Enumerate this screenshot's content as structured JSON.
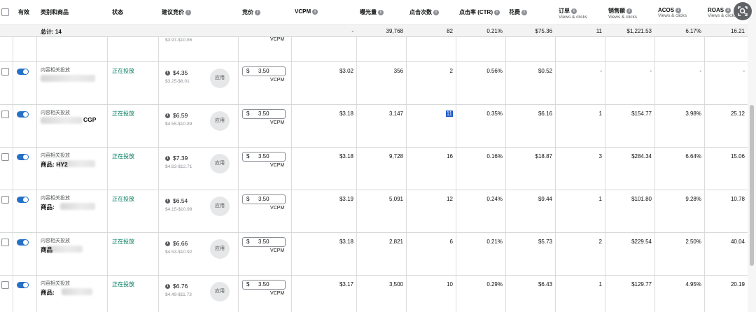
{
  "header": {
    "enabled": "有效",
    "category": "类别和商品",
    "status": "状态",
    "suggested_bid": "建议竞价",
    "bid": "竞价",
    "vcpm": "VCPM",
    "impressions": "曝光量",
    "clicks": "点击次数",
    "ctr": "点击率 (CTR)",
    "spend": "花费",
    "orders": "订单",
    "orders_sub": "Views & clicks",
    "sales": "销售额",
    "sales_sub": "Views & clicks",
    "acos": "ACOS",
    "acos_sub": "Views & clicks",
    "roas": "ROAS",
    "roas_sub": "Views & clicks"
  },
  "totals": {
    "label": "总计: 14",
    "vcpm": "-",
    "impressions": "39,768",
    "clicks": "82",
    "ctr": "0.21%",
    "spend": "$75.36",
    "orders": "11",
    "sales": "$1,221.53",
    "acos": "6.17%",
    "roas": "16.21",
    "partial_range": "$3.97-$10.86",
    "partial_vcpm": "VCPM"
  },
  "rows": [
    {
      "category": "内容相关投放",
      "product": "",
      "status": "正在投放",
      "bid_suggest": "$4.35",
      "bid_range": "$3.25-$8.01",
      "apply": "应用",
      "cur": "$",
      "bid": "3.50",
      "bid_type": "VCPM",
      "vcpm": "$3.02",
      "impressions": "356",
      "clicks": "2",
      "ctr": "0.56%",
      "spend": "$0.52",
      "orders": "-",
      "sales": "-",
      "acos": "-",
      "roas": "-"
    },
    {
      "category": "内容相关投放",
      "product": "CGP",
      "status": "正在投放",
      "bid_suggest": "$6.59",
      "bid_range": "$4.55-$10.89",
      "apply": "应用",
      "cur": "$",
      "bid": "3.50",
      "bid_type": "VCPM",
      "vcpm": "$3.18",
      "impressions": "3,147",
      "clicks": "11",
      "ctr": "0.35%",
      "spend": "$6.16",
      "orders": "1",
      "sales": "$154.77",
      "acos": "3.98%",
      "roas": "25.12"
    },
    {
      "category": "内容相关投放",
      "product": "商品: HY2",
      "status": "正在投放",
      "bid_suggest": "$7.39",
      "bid_range": "$4.83-$12.71",
      "apply": "应用",
      "cur": "$",
      "bid": "3.50",
      "bid_type": "VCPM",
      "vcpm": "$3.18",
      "impressions": "9,728",
      "clicks": "16",
      "ctr": "0.16%",
      "spend": "$18.87",
      "orders": "3",
      "sales": "$284.34",
      "acos": "6.64%",
      "roas": "15.06"
    },
    {
      "category": "内容相关投放",
      "product": "商品:",
      "status": "正在投放",
      "bid_suggest": "$6.54",
      "bid_range": "$4.15-$10.98",
      "apply": "应用",
      "cur": "$",
      "bid": "3.50",
      "bid_type": "VCPM",
      "vcpm": "$3.19",
      "impressions": "5,091",
      "clicks": "12",
      "ctr": "0.24%",
      "spend": "$9.44",
      "orders": "1",
      "sales": "$101.80",
      "acos": "9.28%",
      "roas": "10.78"
    },
    {
      "category": "内容相关投放",
      "product": "商品",
      "status": "正在投放",
      "bid_suggest": "$6.66",
      "bid_range": "$4.53-$10.92",
      "apply": "应用",
      "cur": "$",
      "bid": "3.50",
      "bid_type": "VCPM",
      "vcpm": "$3.18",
      "impressions": "2,821",
      "clicks": "6",
      "ctr": "0.21%",
      "spend": "$5.73",
      "orders": "2",
      "sales": "$229.54",
      "acos": "2.50%",
      "roas": "40.04"
    },
    {
      "category": "内容相关投放",
      "product": "商品:",
      "status": "正在投放",
      "bid_suggest": "$6.76",
      "bid_range": "$4.49-$11.73",
      "apply": "应用",
      "cur": "$",
      "bid": "3.50",
      "bid_type": "VCPM",
      "vcpm": "$3.17",
      "impressions": "3,500",
      "clicks": "10",
      "ctr": "0.29%",
      "spend": "$6.43",
      "orders": "1",
      "sales": "$129.77",
      "acos": "4.95%",
      "roas": "20.19"
    }
  ]
}
